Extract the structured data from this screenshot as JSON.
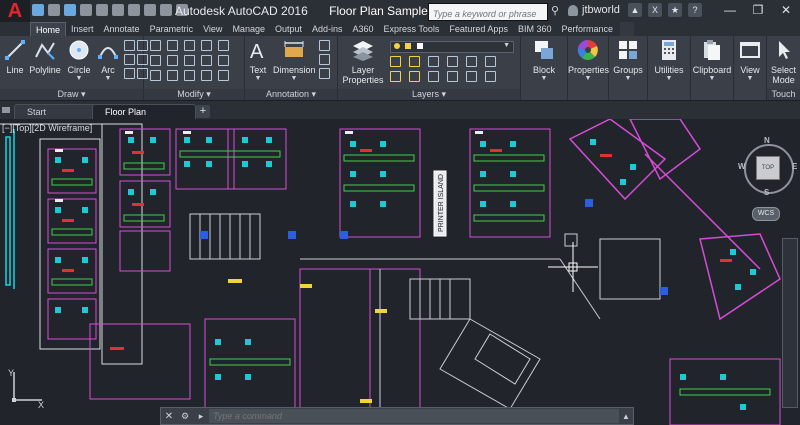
{
  "titlebar": {
    "app_title": "Autodesk AutoCAD 2016",
    "file_name": "Floor Plan Sample.dwg",
    "search_placeholder": "Type a keyword or phrase",
    "username": "jtbworld"
  },
  "ribbon_tabs": [
    "Home",
    "Insert",
    "Annotate",
    "Parametric",
    "View",
    "Manage",
    "Output",
    "Add-ins",
    "A360",
    "Express Tools",
    "Featured Apps",
    "BIM 360",
    "Performance"
  ],
  "ribbon": {
    "draw": {
      "title": "Draw",
      "line": "Line",
      "polyline": "Polyline",
      "circle": "Circle",
      "arc": "Arc"
    },
    "modify": {
      "title": "Modify"
    },
    "annotation": {
      "title": "Annotation",
      "text": "Text",
      "dimension": "Dimension"
    },
    "layers": {
      "title": "Layers",
      "layer_properties_1": "Layer",
      "layer_properties_2": "Properties"
    },
    "block": "Block",
    "properties": "Properties",
    "groups": "Groups",
    "utilities": "Utilities",
    "clipboard": "Clipboard",
    "view": "View",
    "select_mode_1": "Select",
    "select_mode_2": "Mode",
    "touch": "Touch"
  },
  "doc_tabs": {
    "start": "Start",
    "active": "Floor Plan Sample*"
  },
  "viewport": {
    "controls": "[−][Top][2D Wireframe]",
    "viewcube_top": "TOP",
    "n": "N",
    "s": "S",
    "e": "E",
    "w": "W",
    "wcs": "WCS",
    "ucs_x": "X",
    "ucs_y": "Y",
    "printer_island": "PRINTER ISLAND"
  },
  "command_line": {
    "placeholder": "Type a command"
  }
}
